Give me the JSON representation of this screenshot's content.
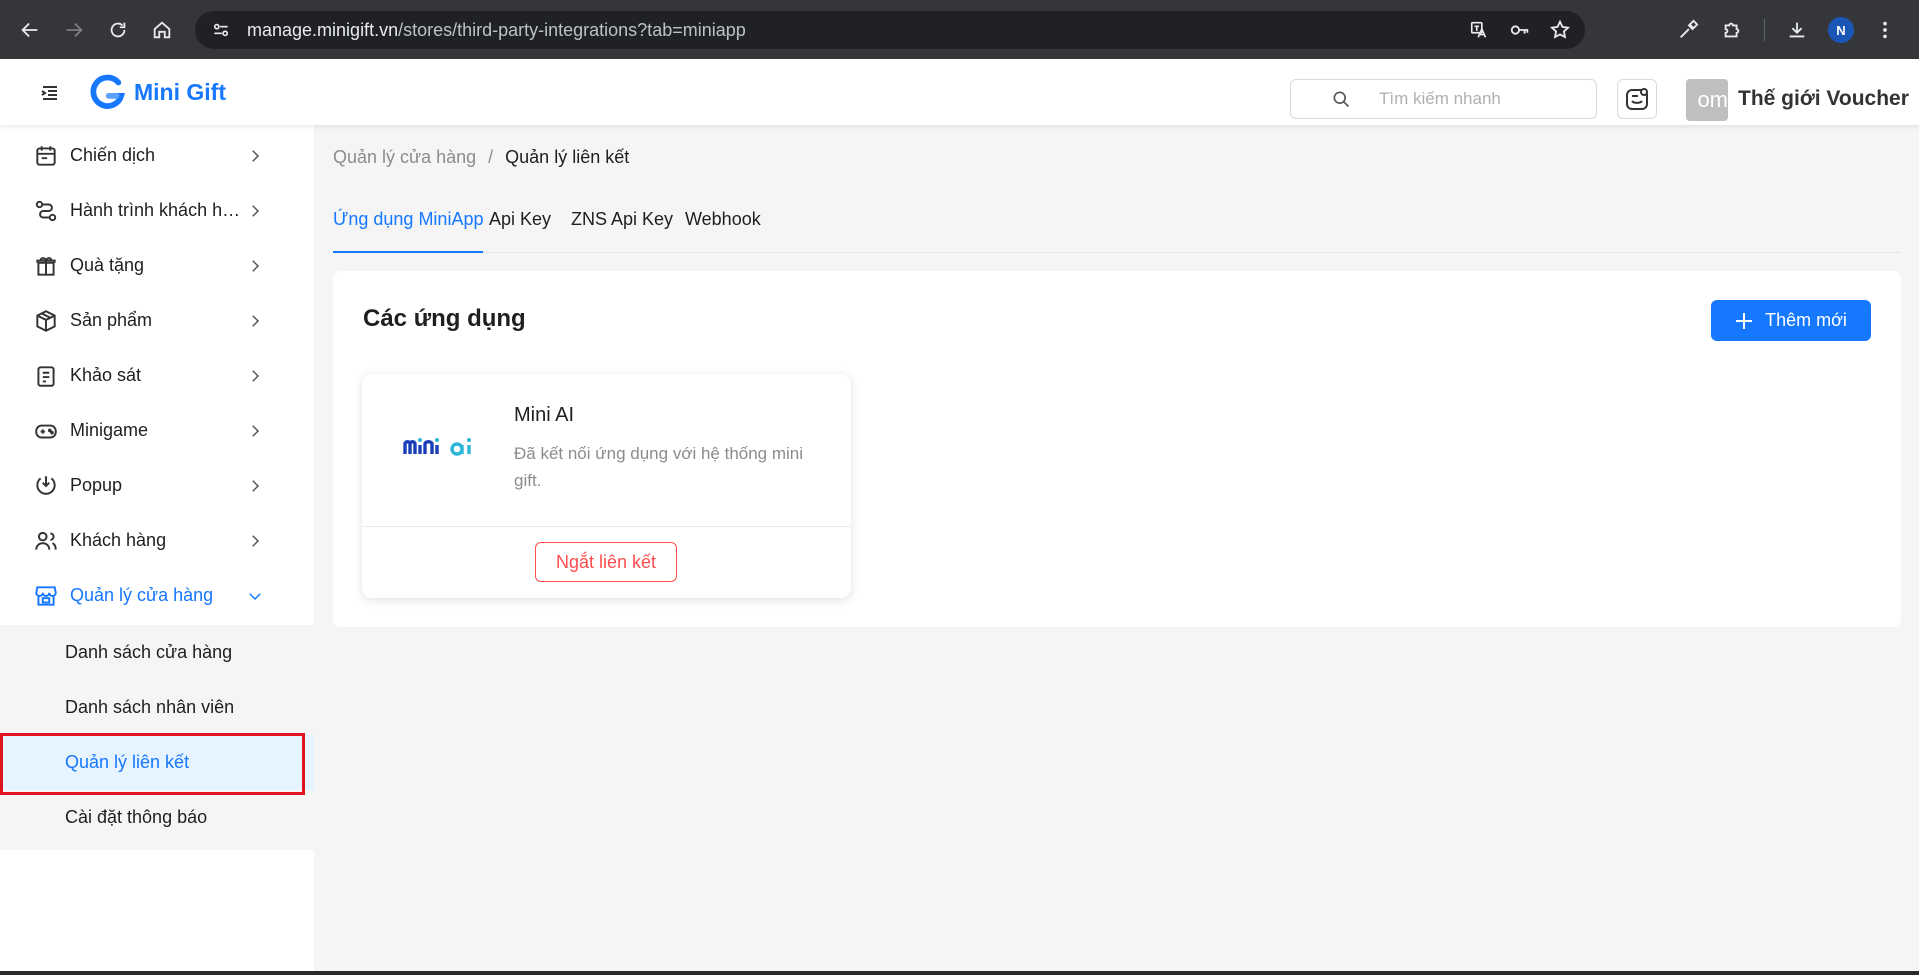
{
  "browser": {
    "url_host": "manage.minigift.vn",
    "url_path": "/stores/third-party-integrations?tab=miniapp",
    "profile_initial": "N"
  },
  "header": {
    "logo_text": "Mini Gift",
    "search_placeholder": "Tìm kiếm nhanh",
    "avatar_text": "om",
    "store_name": "Thế giới Voucher"
  },
  "sidebar": {
    "items": [
      {
        "label": "Chiến dịch",
        "icon": "calendar-icon"
      },
      {
        "label": "Hành trình khách hàng",
        "icon": "journey-icon"
      },
      {
        "label": "Quà tặng",
        "icon": "gift-icon"
      },
      {
        "label": "Sản phẩm",
        "icon": "box-icon"
      },
      {
        "label": "Khảo sát",
        "icon": "survey-icon"
      },
      {
        "label": "Minigame",
        "icon": "gamepad-icon"
      },
      {
        "label": "Popup",
        "icon": "popup-icon"
      },
      {
        "label": "Khách hàng",
        "icon": "users-icon"
      },
      {
        "label": "Quản lý cửa hàng",
        "icon": "store-icon"
      }
    ],
    "submenu": [
      {
        "label": "Danh sách cửa hàng"
      },
      {
        "label": "Danh sách nhân viên"
      },
      {
        "label": "Quản lý liên kết"
      },
      {
        "label": "Cài đặt thông báo"
      }
    ]
  },
  "breadcrumb": {
    "parent": "Quản lý cửa hàng",
    "separator": "/",
    "current": "Quản lý liên kết"
  },
  "tabs": [
    {
      "label": "Ứng dụng MiniApp"
    },
    {
      "label": "Api Key"
    },
    {
      "label": "ZNS Api Key"
    },
    {
      "label": "Webhook"
    }
  ],
  "apps_section": {
    "title": "Các ứng dụng",
    "add_label": "Thêm mới"
  },
  "app": {
    "name": "Mini AI",
    "description": "Đã kết nối ứng dụng với hệ thống mini gift.",
    "unlink_label": "Ngắt liên kết"
  },
  "colors": {
    "primary": "#1677ff",
    "danger": "#ff4d4f",
    "annotation": "#e0141e"
  }
}
